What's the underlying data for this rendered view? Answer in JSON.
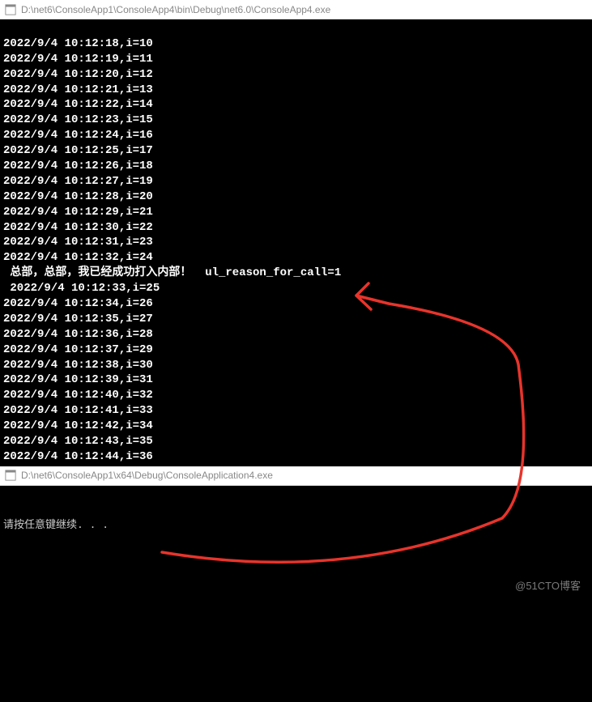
{
  "window1": {
    "title": "D:\\net6\\ConsoleApp1\\ConsoleApp4\\bin\\Debug\\net6.0\\ConsoleApp4.exe",
    "lines": [
      "",
      "2022/9/4 10:12:18,i=10",
      "2022/9/4 10:12:19,i=11",
      "2022/9/4 10:12:20,i=12",
      "2022/9/4 10:12:21,i=13",
      "2022/9/4 10:12:22,i=14",
      "2022/9/4 10:12:23,i=15",
      "2022/9/4 10:12:24,i=16",
      "2022/9/4 10:12:25,i=17",
      "2022/9/4 10:12:26,i=18",
      "2022/9/4 10:12:27,i=19",
      "2022/9/4 10:12:28,i=20",
      "2022/9/4 10:12:29,i=21",
      "2022/9/4 10:12:30,i=22",
      "2022/9/4 10:12:31,i=23",
      "2022/9/4 10:12:32,i=24",
      " 总部，总部，我已经成功打入内部！  ul_reason_for_call=1",
      " 2022/9/4 10:12:33,i=25",
      "2022/9/4 10:12:34,i=26",
      "2022/9/4 10:12:35,i=27",
      "2022/9/4 10:12:36,i=28",
      "2022/9/4 10:12:37,i=29",
      "2022/9/4 10:12:38,i=30",
      "2022/9/4 10:12:39,i=31",
      "2022/9/4 10:12:40,i=32",
      "2022/9/4 10:12:41,i=33",
      "2022/9/4 10:12:42,i=34",
      "2022/9/4 10:12:43,i=35",
      "2022/9/4 10:12:44,i=36"
    ]
  },
  "window2": {
    "title": "D:\\net6\\ConsoleApp1\\x64\\Debug\\ConsoleApplication4.exe",
    "prompt": "请按任意键继续. . ."
  },
  "watermark": "@51CTO博客"
}
